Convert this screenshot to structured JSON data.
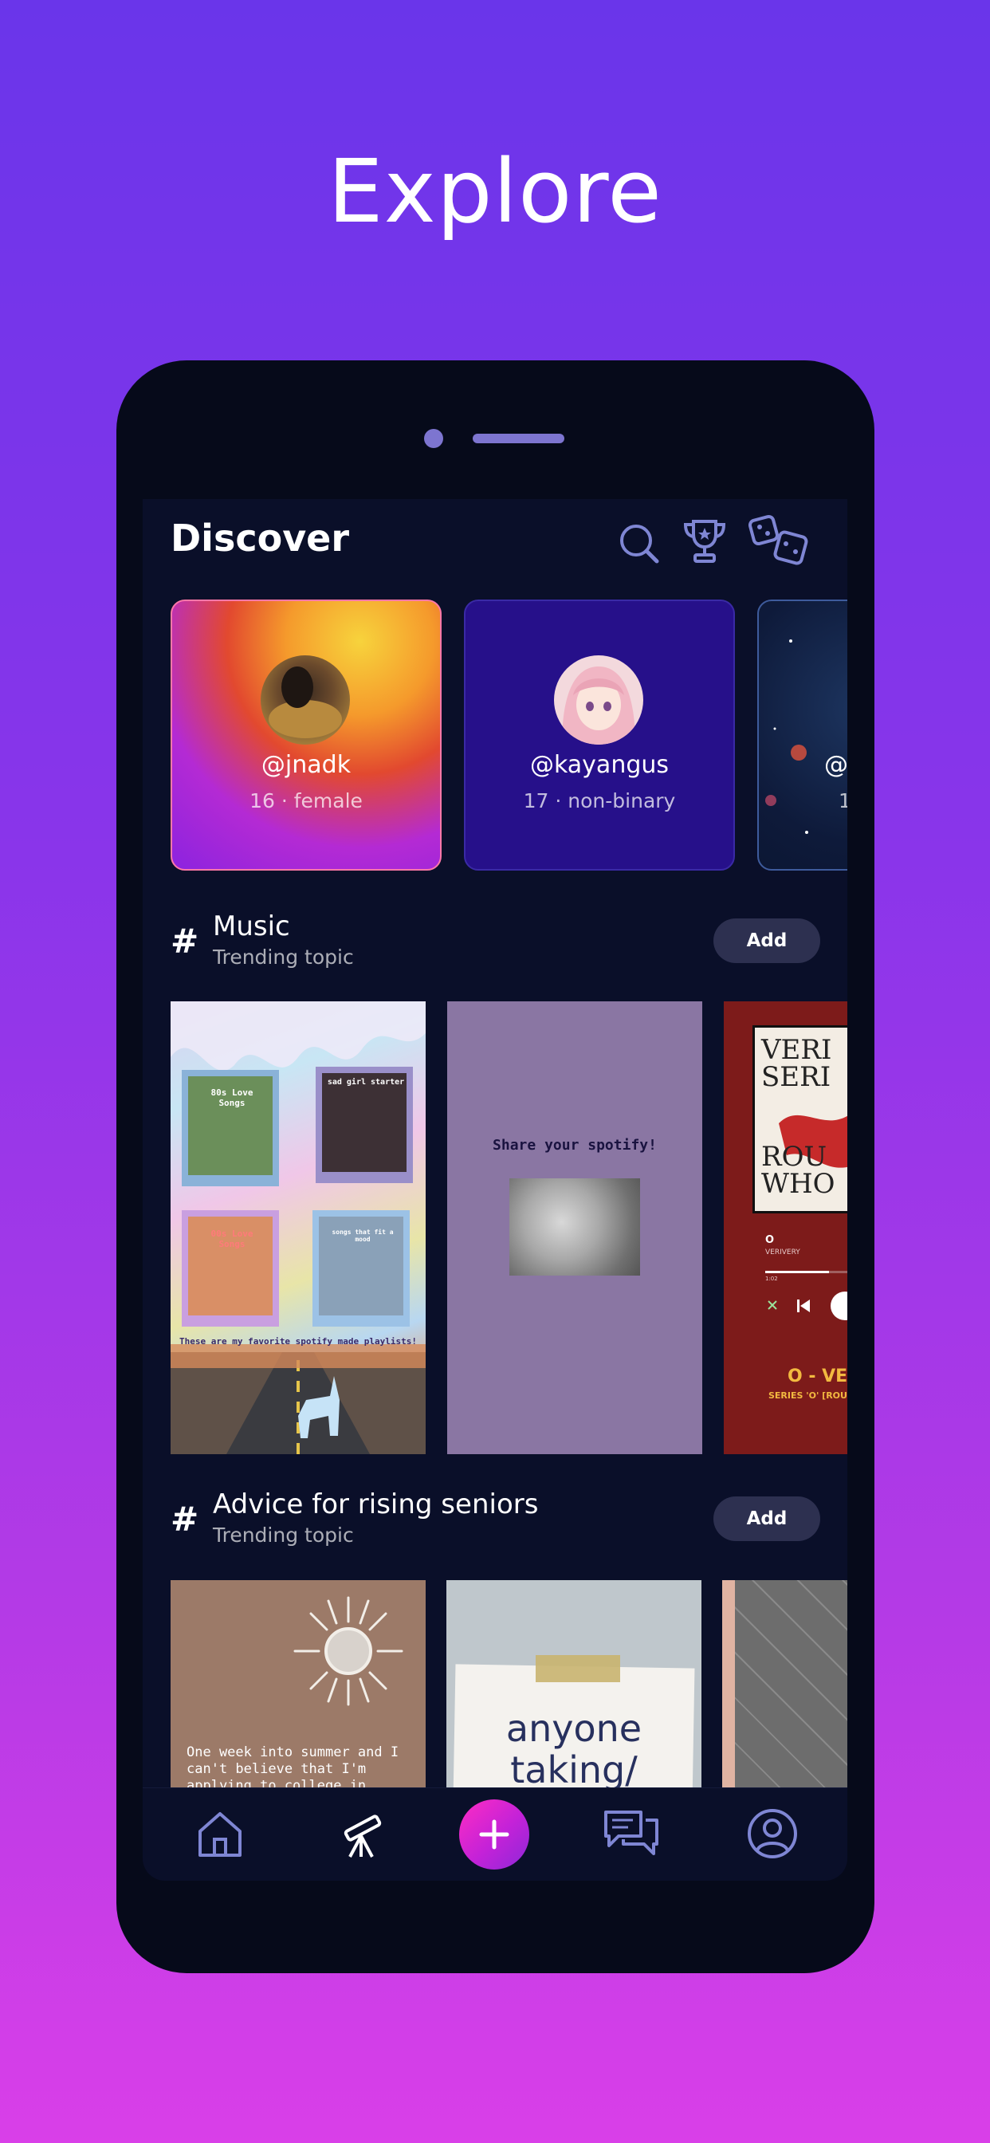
{
  "headline": "Explore",
  "header": {
    "title": "Discover"
  },
  "profiles": [
    {
      "handle": "@jnadk",
      "meta": "16 · female"
    },
    {
      "handle": "@kayangus",
      "meta": "17 · non-binary"
    },
    {
      "handle": "@",
      "meta": "1"
    }
  ],
  "topics": [
    {
      "title": "Music",
      "subtitle": "Trending topic",
      "add_label": "Add",
      "post1": {
        "tile1": "80s Love Songs",
        "tile2": "sad girl starter",
        "tile3": "00s Love Songs",
        "tile4": "songs that fit a mood",
        "caption": "These are my favorite spotify made playlists!"
      },
      "post2": {
        "text": "Share your spotify!"
      },
      "post3": {
        "cover_line1": "VERI",
        "cover_line2": "SERI",
        "cover_line3": "ROU",
        "cover_line4": "WHO",
        "song": "O",
        "artist": "VERIVERY",
        "time": "1:02",
        "title": "O - VER",
        "subtitle": "SERIES 'O' [ROUN"
      }
    },
    {
      "title": "Advice for rising seniors",
      "subtitle": "Trending topic",
      "add_label": "Add",
      "post1": {
        "text": "One week into summer and I can't believe that I'm applying to college in"
      },
      "post2": {
        "text_line1": "anyone",
        "text_line2": "taking/"
      }
    }
  ],
  "nav": {
    "items": [
      "home",
      "explore",
      "create",
      "messages",
      "profile"
    ]
  },
  "colors": {
    "accent": "#ff2cc3",
    "screen_bg": "#0a0f29",
    "icon": "#7f86d4"
  }
}
